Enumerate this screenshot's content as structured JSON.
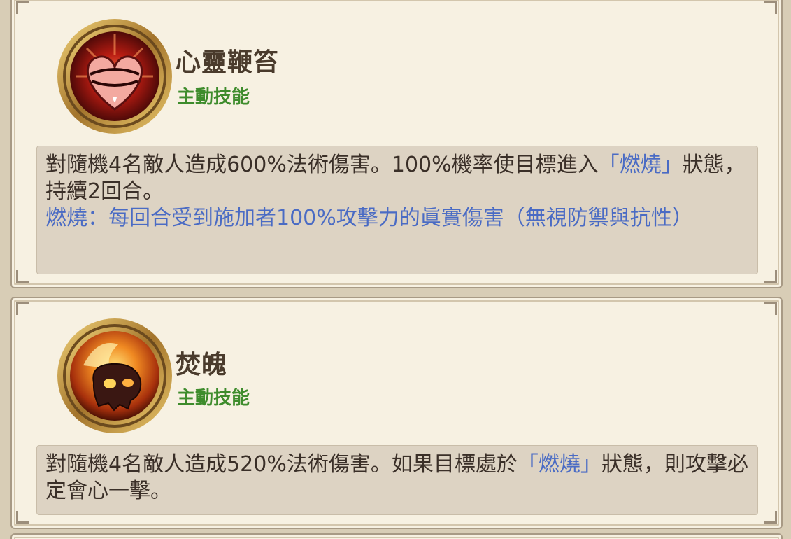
{
  "skills": [
    {
      "name": "心靈鞭笞",
      "type": "主動技能",
      "icon": "flaming-heart-icon",
      "desc_part1": "對隨機4名敵人造成600%法術傷害。100%機率使目標進入",
      "desc_status": "「燃燒」",
      "desc_part2": "狀態， 持續2回合。",
      "note": "燃燒：每回合受到施加者100%攻擊力的眞實傷害（無視防禦與抗性）"
    },
    {
      "name": "焚魄",
      "type": "主動技能",
      "icon": "burning-skull-icon",
      "desc_part1": "對隨機4名敵人造成520%法術傷害。如果目標處於",
      "desc_status": "「燃燒」",
      "desc_part2": "狀態，則攻擊必定會心一擊。"
    }
  ],
  "colors": {
    "skill_type": "#3e8c2c",
    "status_keyword": "#4a6bc4",
    "card_bg": "#f7f1e2",
    "desc_bg": "#ddd3c3"
  }
}
